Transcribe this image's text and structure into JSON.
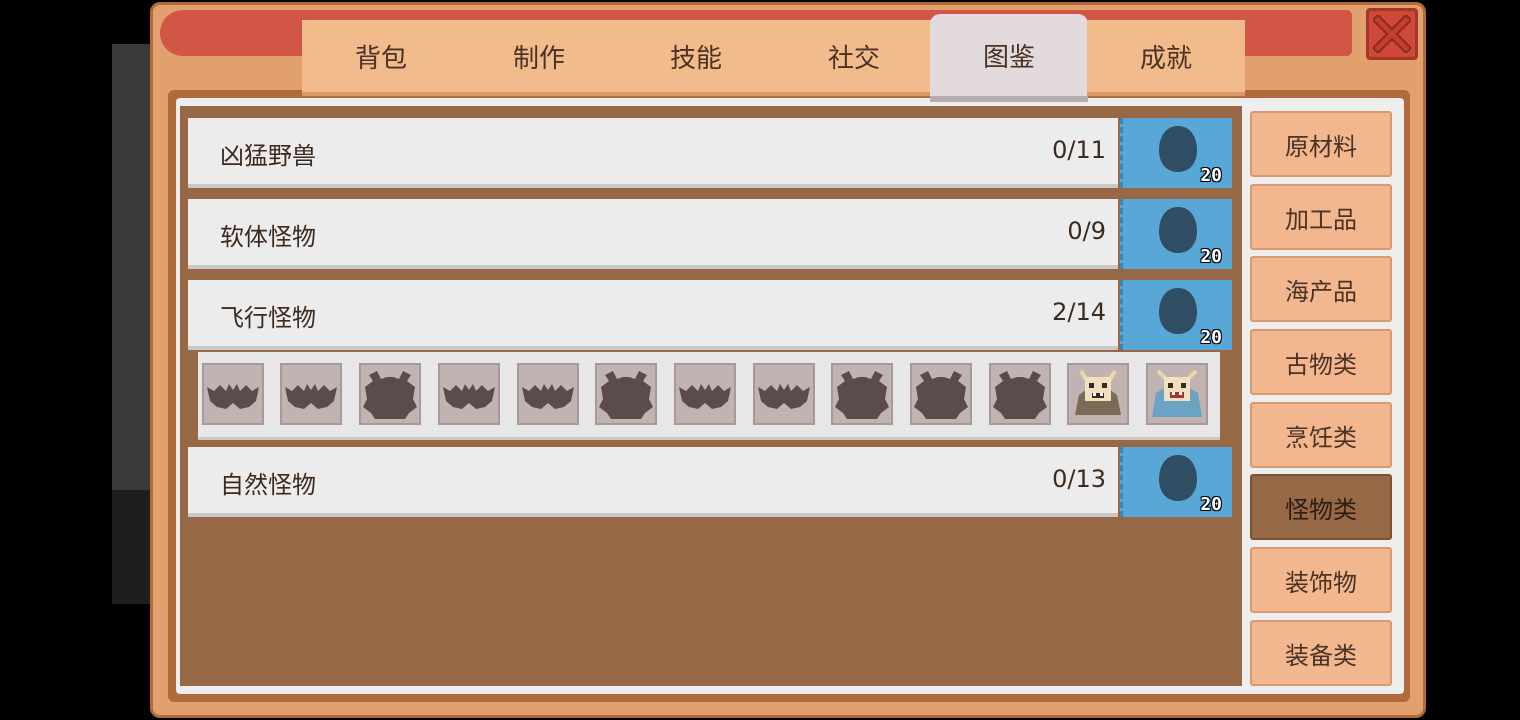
{
  "window": {
    "close_icon": "close-x-icon"
  },
  "tabs": [
    {
      "label": "背包"
    },
    {
      "label": "制作"
    },
    {
      "label": "技能"
    },
    {
      "label": "社交"
    },
    {
      "label": "图鉴",
      "active": true
    },
    {
      "label": "成就"
    }
  ],
  "categories": [
    {
      "name": "凶猛野兽",
      "progress": "0/11",
      "reward": "20"
    },
    {
      "name": "软体怪物",
      "progress": "0/9",
      "reward": "20"
    },
    {
      "name": "飞行怪物",
      "progress": "2/14",
      "reward": "20",
      "expanded": true
    },
    {
      "name": "自然怪物",
      "progress": "0/13",
      "reward": "20"
    }
  ],
  "flying_monsters": [
    {
      "icon": "bat-silhouette-icon",
      "discovered": false
    },
    {
      "icon": "bat-silhouette-icon",
      "discovered": false
    },
    {
      "icon": "winged-beast-silhouette-icon",
      "discovered": false
    },
    {
      "icon": "bat-silhouette-icon",
      "discovered": false
    },
    {
      "icon": "bat-silhouette-icon",
      "discovered": false
    },
    {
      "icon": "winged-beast-silhouette-icon",
      "discovered": false
    },
    {
      "icon": "bat-silhouette-icon",
      "discovered": false
    },
    {
      "icon": "bat-silhouette-icon",
      "discovered": false
    },
    {
      "icon": "winged-beast-silhouette-icon",
      "discovered": false
    },
    {
      "icon": "winged-beast-silhouette-icon",
      "discovered": false
    },
    {
      "icon": "winged-beast-silhouette-icon",
      "discovered": false
    },
    {
      "icon": "horned-monster-brown-icon",
      "discovered": true
    },
    {
      "icon": "horned-monster-blue-icon",
      "discovered": true
    }
  ],
  "sidebar": [
    {
      "label": "原材料"
    },
    {
      "label": "加工品"
    },
    {
      "label": "海产品"
    },
    {
      "label": "古物类"
    },
    {
      "label": "烹饪类"
    },
    {
      "label": "怪物类",
      "active": true
    },
    {
      "label": "装饰物"
    },
    {
      "label": "装备类"
    }
  ],
  "colors": {
    "frame": "#e2a06e",
    "title_bar": "#d25645",
    "content_bg": "#976845",
    "reward_bg": "#58a7d6",
    "tab_active": "#e2dadc"
  }
}
